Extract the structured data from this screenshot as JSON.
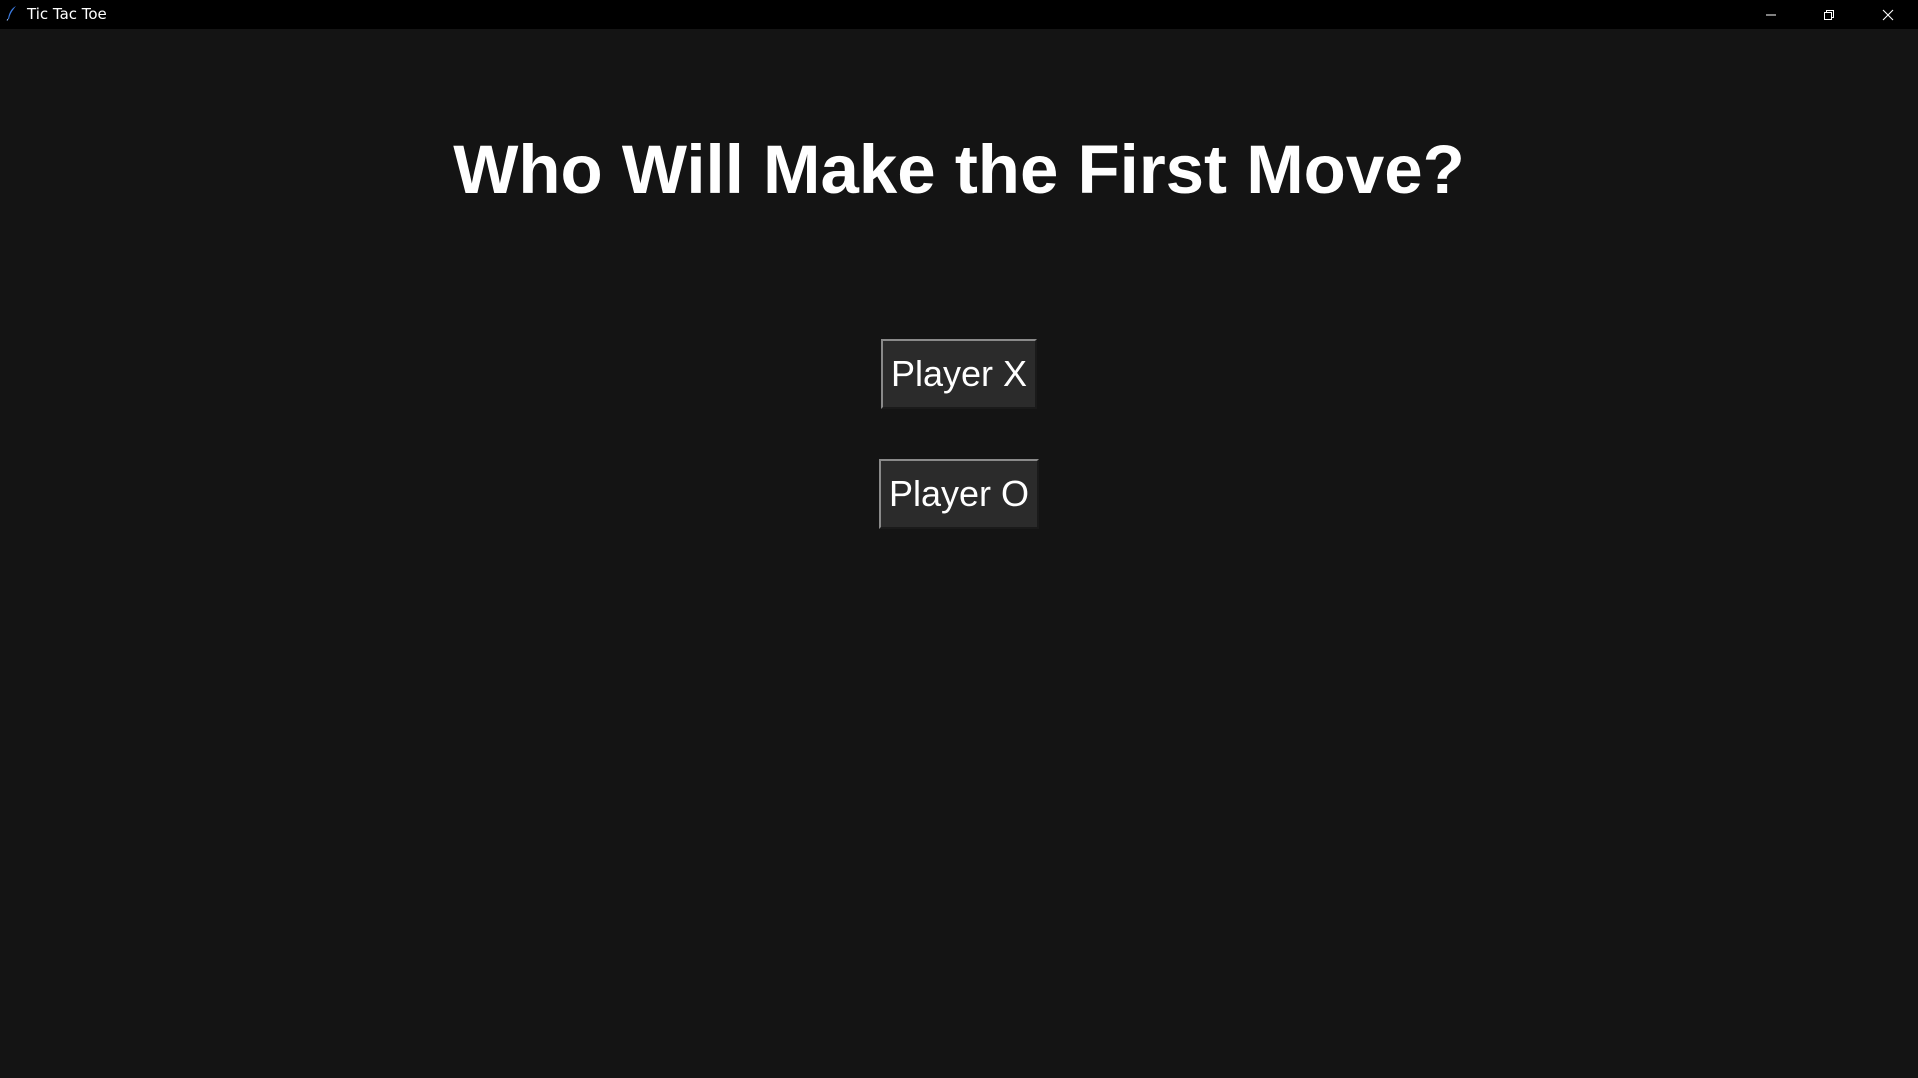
{
  "window": {
    "title": "Tic Tac Toe",
    "icon": "feather-icon",
    "controls": {
      "minimize": "minimize-icon",
      "maximize": "restore-icon",
      "close": "close-icon"
    }
  },
  "main": {
    "heading": "Who Will Make the First Move?",
    "buttons": [
      {
        "label": "Player X"
      },
      {
        "label": "Player O"
      }
    ]
  },
  "colors": {
    "background": "#141414",
    "titlebar": "#000000",
    "button_bg": "#2b2b2b",
    "text": "#ffffff"
  }
}
